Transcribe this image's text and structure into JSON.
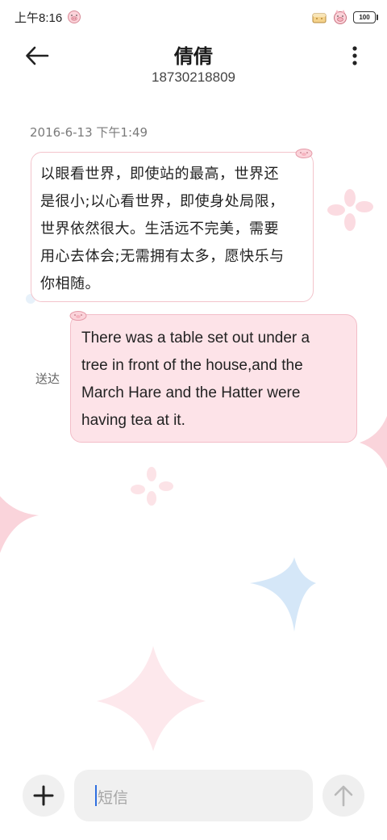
{
  "status_bar": {
    "time": "上午8:16",
    "battery": "100"
  },
  "header": {
    "contact_name": "倩倩",
    "contact_number": "18730218809",
    "back_icon": "arrow-left-icon",
    "more_icon": "vertical-dots-icon"
  },
  "conversation": {
    "timestamp": "2016-6-13 下午1:49",
    "incoming_message": {
      "lines": [
        "以眼看世界，即使站的最高，世界还",
        "是很小;以心看世界，即使身处局限，",
        "世界依然很大。生活远不完美，需要",
        "用心去体会;无需拥有太多，愿快乐与",
        "你相随。"
      ]
    },
    "outgoing_message": {
      "lines": [
        "There was a table set out under a",
        "tree in front of the house,and the",
        "March Hare and the Hatter were",
        "having tea at it."
      ],
      "status": "送达"
    }
  },
  "composer": {
    "placeholder": "短信",
    "add_icon": "plus-icon",
    "send_icon": "arrow-up-icon"
  },
  "colors": {
    "incoming_border": "#f3c4cc",
    "outgoing_fill": "#fde3e8",
    "decor_pink": "#f7c6cf",
    "decor_blue": "#cfe3f7",
    "caret": "#2f6fe0"
  }
}
